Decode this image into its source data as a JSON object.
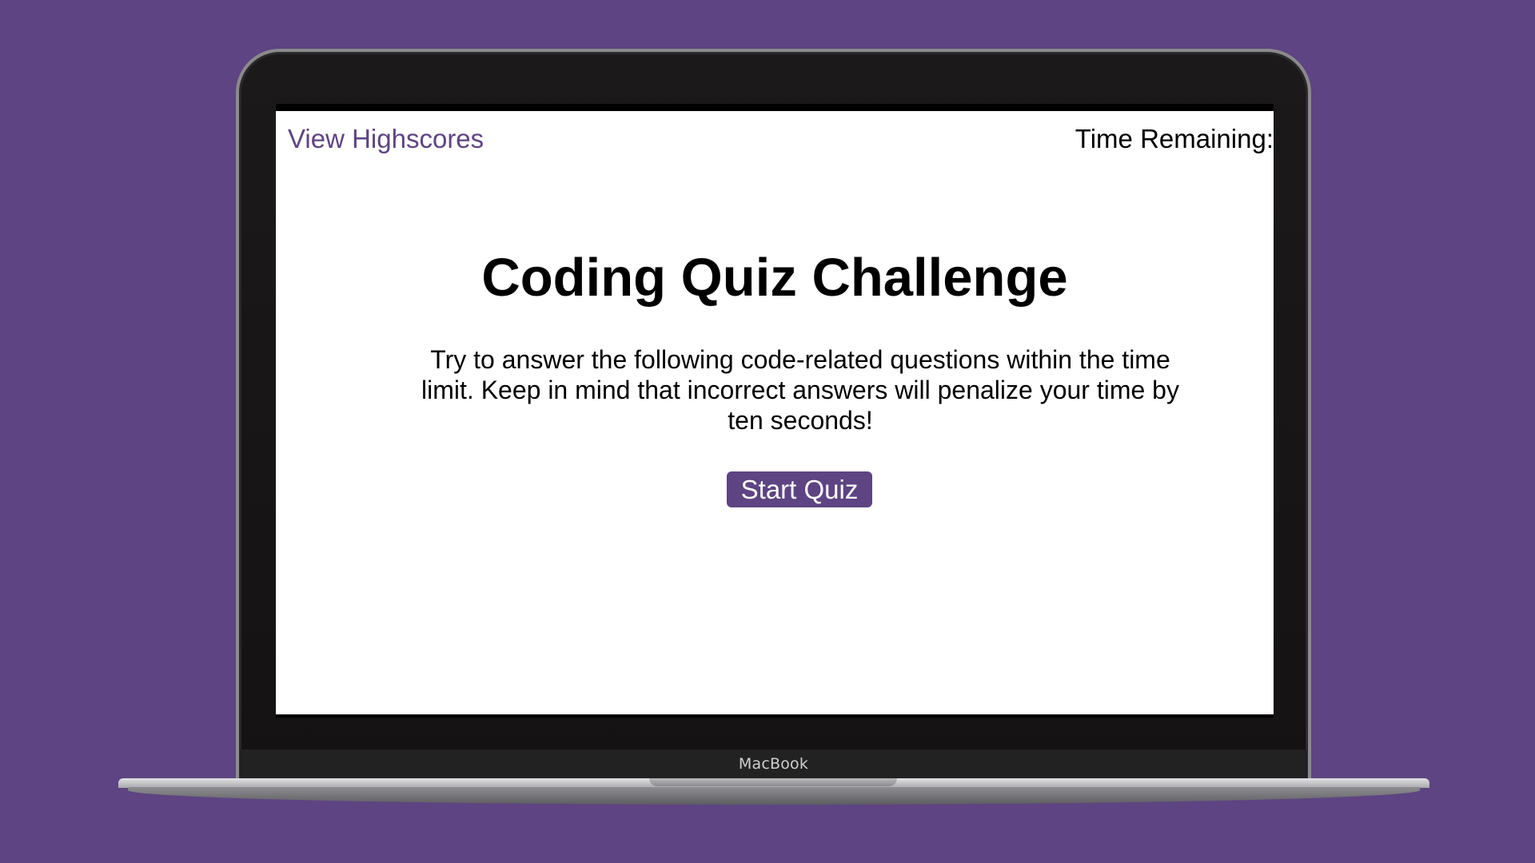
{
  "device": {
    "brand_label": "MacBook"
  },
  "header": {
    "highscores_link": "View Highscores",
    "timer_label": "Time Remaining:",
    "timer_value": ""
  },
  "main": {
    "title": "Coding Quiz Challenge",
    "intro": "Try to answer the following code-related questions within the time limit. Keep in mind that incorrect answers will penalize your time by ten seconds!",
    "start_button": "Start Quiz"
  },
  "colors": {
    "background": "#5e4482",
    "accent": "#5e4482",
    "page": "#ffffff",
    "text": "#000000"
  }
}
